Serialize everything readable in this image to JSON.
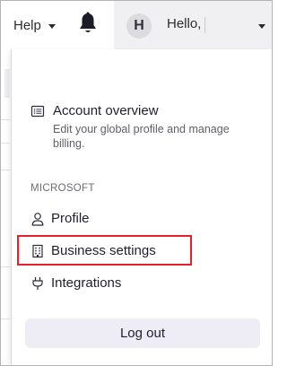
{
  "header": {
    "help_label": "Help",
    "avatar_initial": "H",
    "greeting": "Hello,"
  },
  "menu": {
    "account": {
      "title": "Account overview",
      "description": "Edit your global profile and manage billing."
    },
    "section_label": "MICROSOFT",
    "items": [
      {
        "label": "Profile",
        "icon": "person-icon"
      },
      {
        "label": "Business settings",
        "icon": "building-icon",
        "highlighted": true
      },
      {
        "label": "Integrations",
        "icon": "plug-icon"
      }
    ],
    "logout_label": "Log out"
  },
  "colors": {
    "highlight_border": "#e8202a",
    "logout_bg": "#eeedf5",
    "user_area_bg": "#f0f0f2"
  }
}
